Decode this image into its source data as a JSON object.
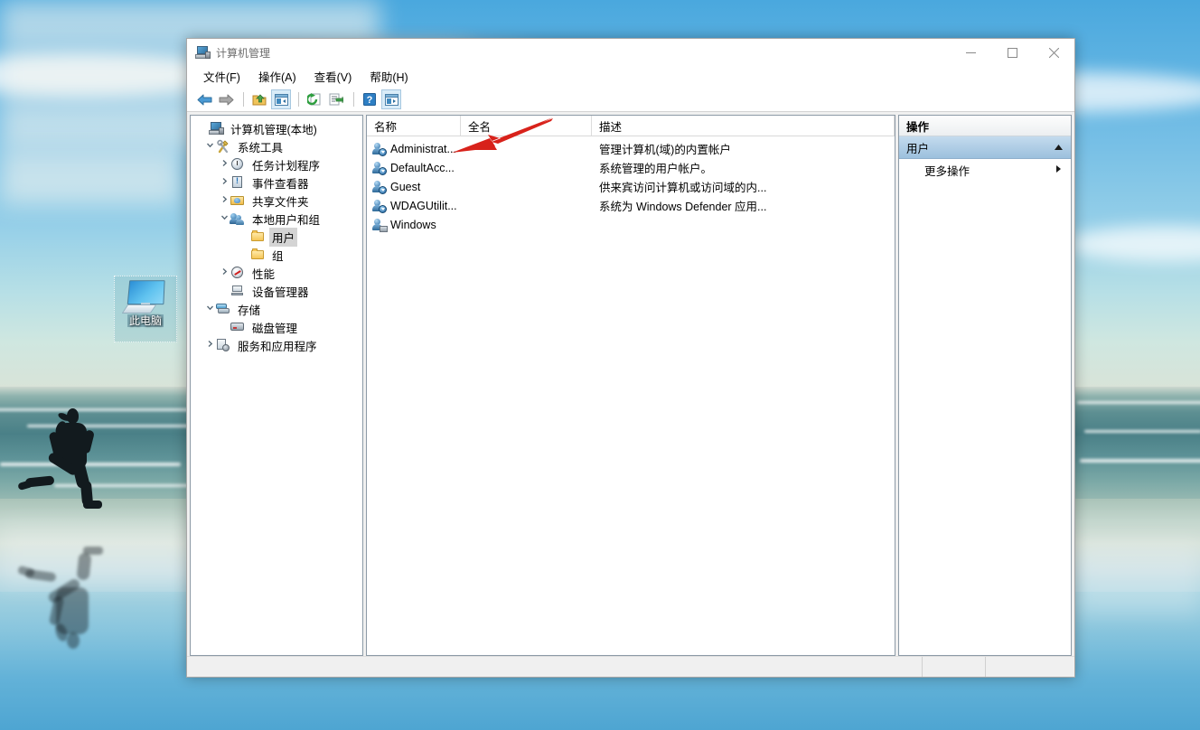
{
  "desktop": {
    "icon": {
      "label": "此电脑",
      "name": "this-pc-icon"
    },
    "wallpaper_colors": {
      "sky_top": "#4aa8de",
      "sky_bottom": "#d8e3d8",
      "sea": "#4a8087",
      "sand": "#d6e2da",
      "wet_sand": "#4ea5d2"
    }
  },
  "window": {
    "title": "计算机管理",
    "title_icon": "mmc-console-icon",
    "controls": {
      "minimize": "最小化",
      "maximize": "最大化",
      "close": "关闭"
    },
    "menu": [
      {
        "label": "文件(F)",
        "name": "menu-file"
      },
      {
        "label": "操作(A)",
        "name": "menu-action"
      },
      {
        "label": "查看(V)",
        "name": "menu-view"
      },
      {
        "label": "帮助(H)",
        "name": "menu-help"
      }
    ],
    "toolbar": [
      {
        "name": "back-icon",
        "framed": false
      },
      {
        "name": "forward-icon",
        "framed": false
      },
      {
        "name": "separator-1",
        "framed": false
      },
      {
        "name": "up-folder-icon",
        "framed": false
      },
      {
        "name": "show-hide-tree-icon",
        "framed": true
      },
      {
        "name": "separator-2",
        "framed": false
      },
      {
        "name": "refresh-icon",
        "framed": false
      },
      {
        "name": "export-list-icon",
        "framed": false
      },
      {
        "name": "separator-3",
        "framed": false
      },
      {
        "name": "help-icon",
        "framed": false
      },
      {
        "name": "show-action-pane-icon",
        "framed": true
      }
    ]
  },
  "tree": {
    "nodes": [
      {
        "label": "计算机管理(本地)",
        "icon": "computer-management-icon",
        "indent": 0,
        "twist": "",
        "selected": false
      },
      {
        "label": "系统工具",
        "icon": "system-tools-icon",
        "indent": 1,
        "twist": "v",
        "selected": false
      },
      {
        "label": "任务计划程序",
        "icon": "task-scheduler-icon",
        "indent": 2,
        "twist": ">",
        "selected": false
      },
      {
        "label": "事件查看器",
        "icon": "event-viewer-icon",
        "indent": 2,
        "twist": ">",
        "selected": false
      },
      {
        "label": "共享文件夹",
        "icon": "shared-folders-icon",
        "indent": 2,
        "twist": ">",
        "selected": false
      },
      {
        "label": "本地用户和组",
        "icon": "local-users-groups-icon",
        "indent": 2,
        "twist": "v",
        "selected": false
      },
      {
        "label": "用户",
        "icon": "folder-icon",
        "indent": 3,
        "twist": "",
        "selected": true
      },
      {
        "label": "组",
        "icon": "folder-icon",
        "indent": 3,
        "twist": "",
        "selected": false
      },
      {
        "label": "性能",
        "icon": "performance-icon",
        "indent": 2,
        "twist": ">",
        "selected": false
      },
      {
        "label": "设备管理器",
        "icon": "device-manager-icon",
        "indent": 2,
        "twist": "",
        "selected": false
      },
      {
        "label": "存储",
        "icon": "storage-icon",
        "indent": 1,
        "twist": "v",
        "selected": false
      },
      {
        "label": "磁盘管理",
        "icon": "disk-management-icon",
        "indent": 2,
        "twist": "",
        "selected": false
      },
      {
        "label": "服务和应用程序",
        "icon": "services-apps-icon",
        "indent": 1,
        "twist": ">",
        "selected": false
      }
    ]
  },
  "list": {
    "columns": [
      {
        "label": "名称",
        "name": "column-name"
      },
      {
        "label": "全名",
        "name": "column-full-name"
      },
      {
        "label": "描述",
        "name": "column-description"
      }
    ],
    "rows": [
      {
        "name": "Administrat...",
        "full_name": "",
        "description": "管理计算机(域)的内置帐户",
        "icon": "user-disabled-icon"
      },
      {
        "name": "DefaultAcc...",
        "full_name": "",
        "description": "系统管理的用户帐户。",
        "icon": "user-disabled-icon"
      },
      {
        "name": "Guest",
        "full_name": "",
        "description": "供来宾访问计算机或访问域的内...",
        "icon": "user-disabled-icon"
      },
      {
        "name": "WDAGUtilit...",
        "full_name": "",
        "description": "系统为 Windows Defender 应用...",
        "icon": "user-disabled-icon"
      },
      {
        "name": "Windows",
        "full_name": "",
        "description": "",
        "icon": "user-system-icon"
      }
    ]
  },
  "actions": {
    "header": "操作",
    "group": {
      "label": "用户",
      "collapse_icon": "chevron-up-icon"
    },
    "items": [
      {
        "label": "更多操作",
        "submenu_icon": "chevron-right-icon"
      }
    ]
  },
  "statusbar": {
    "cells": [
      "",
      "",
      ""
    ]
  },
  "annotation": {
    "arrow": "red-pointer-arrow",
    "color": "#d8221b"
  }
}
